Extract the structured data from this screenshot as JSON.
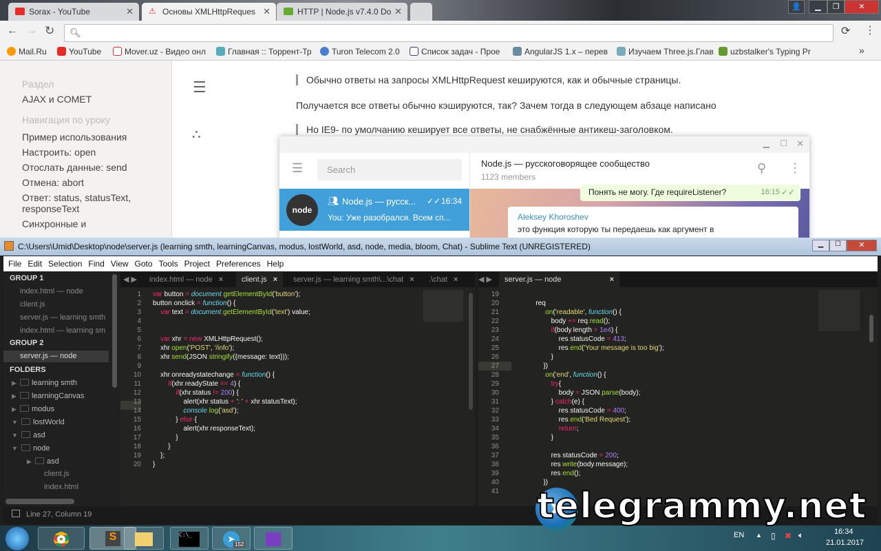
{
  "browser": {
    "tabs": [
      {
        "title": "Sorax - YouTube",
        "color": "#e52d27"
      },
      {
        "title": "Основы XMLHttpReques",
        "color": "#e33"
      },
      {
        "title": "HTTP | Node.js v7.4.0 Do",
        "color": "#6a3"
      }
    ],
    "bookmarks": [
      "Mail.Ru",
      "YouTube",
      "Mover.uz - Видео онл",
      "Главная :: Торрент-Тр",
      "Turon Telecom 2.0",
      "Список задач - Прое",
      "AngularJS 1.x – перев",
      "Изучаем Three.js.Глав",
      "uzbstalker's Typing Pr"
    ],
    "more": "»"
  },
  "page": {
    "section_label": "Раздел",
    "section": "AJAX и COMET",
    "nav_label": "Навигация по уроку",
    "nav": [
      "Пример использования",
      "Настроить: open",
      "Отослать данные: send",
      "Отмена: abort",
      "Ответ: status, statusText, responseText",
      "Синхронные и"
    ],
    "quote1": "Обычно ответы на запросы XMLHttpRequest кешируются, как и обычные страницы.",
    "para": "Получается все ответы обычно кэшируются, так? Зачем тогда в следующем абзаце написано",
    "quote2": "Но IE9- по умолчанию кеширует все ответы, не снабжённые антикеш-заголовком."
  },
  "telegram": {
    "search_placeholder": "Search",
    "chat_title": "Node.js — русскоговорящее сообщество",
    "members": "1123 members",
    "dialog": {
      "name": "Node.js — русск...",
      "time": "16:34",
      "preview": "You: Уже разобрался. Всем сп...",
      "avatar": "node"
    },
    "out_msg": {
      "text": "Понять не могу. Где requireListener?",
      "time": "16:15"
    },
    "in_msg": {
      "author": "Aleksey Khoroshev",
      "text": "это функция которую ты передаешь как аргумент в"
    },
    "accent": "#419fd9"
  },
  "sublime": {
    "title": "C:\\Users\\Umid\\Desktop\\node\\server.js (learning smth, learningCanvas, modus, lostWorld, asd, node, media, bloom, Chat) - Sublime Text (UNREGISTERED)",
    "menu": [
      "File",
      "Edit",
      "Selection",
      "Find",
      "View",
      "Goto",
      "Tools",
      "Project",
      "Preferences",
      "Help"
    ],
    "sidebar": {
      "group1": "GROUP 1",
      "group1_files": [
        "index.html — node",
        "client.js",
        "server.js — learning smth",
        "index.html — learning sm"
      ],
      "group2": "GROUP 2",
      "group2_files": [
        "server.js — node"
      ],
      "folders_label": "FOLDERS",
      "folders": [
        {
          "name": "learning smth",
          "open": false,
          "depth": 0
        },
        {
          "name": "learningCanvas",
          "open": false,
          "depth": 0
        },
        {
          "name": "modus",
          "open": false,
          "depth": 0
        },
        {
          "name": "lostWorld",
          "open": true,
          "depth": 0
        },
        {
          "name": "asd",
          "open": true,
          "depth": 0
        },
        {
          "name": "node",
          "open": true,
          "depth": 0
        },
        {
          "name": "asd",
          "open": false,
          "depth": 1
        }
      ],
      "files": [
        "client.js",
        "index.html"
      ]
    },
    "left_tabs": [
      "index.html — node",
      "client.js",
      "server.js — learning smth\\...\\chat",
      ".\\chat"
    ],
    "right_tabs": [
      "server.js — node"
    ],
    "left_start": 1,
    "left_code": [
      "var button = document.getElementById('button');",
      "button.onclick = function() {",
      "    var text = document.getElementById('text').value;",
      "",
      "",
      "    var xhr = new XMLHttpRequest();",
      "    xhr.open('POST', '/info');",
      "    xhr.send(JSON.stringify({message: text}));",
      "",
      "    xhr.onreadystatechange = function() {",
      "        if(xhr.readyState == 4) {",
      "            if(xhr.status != 200) {",
      "                alert(xhr.status + ': ' + xhr.statusText);",
      "                console.log('asd');",
      "            } else {",
      "                alert(xhr.responseText);",
      "            }",
      "        }",
      "    };",
      "}"
    ],
    "right_start": 19,
    "right_code": [
      "",
      "            req",
      "                .on('readable', function() {",
      "                    body += req.read();",
      "                    if(body.length > 1e4) {",
      "                        res.statusCode = 413;",
      "                        res.end('Your message is too big');",
      "                    }",
      "                })",
      "                .on('end', function() {",
      "                    try{",
      "                        body = JSON.parse(body);",
      "                    } catch(e) {",
      "                        res.statusCode = 400;",
      "                        res.end('Bed Request');",
      "                        return;",
      "                    }",
      "",
      "                    res.statusCode = 200;",
      "                    res.write(body.message);",
      "                    res.end();",
      "                })",
      ""
    ],
    "status": "Line 27, Column 19"
  },
  "taskbar": {
    "lang": "EN",
    "time": "16:34",
    "date": "21.01.2017",
    "telegram_badge": "152"
  },
  "watermark": "telegrammy.net"
}
